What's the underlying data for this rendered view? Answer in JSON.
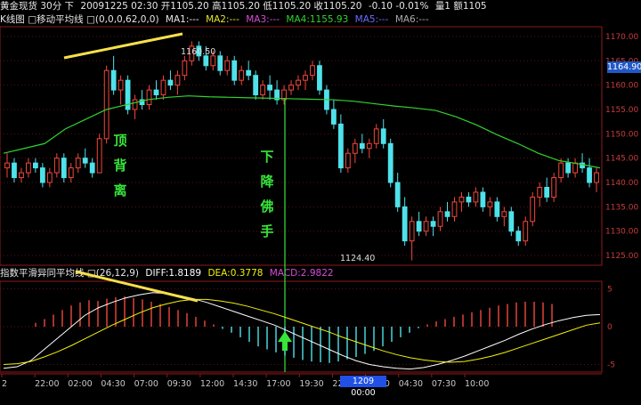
{
  "header": {
    "symbol": "黄金现货 30分 下",
    "info": "20091225 02:30 开1105.20 高1105.20 低1105.20 收1105.20",
    "change": "-0.10 -0.01%",
    "volume": "量1 额1105"
  },
  "ma_header": {
    "title": "K线图 □移动平均线 □(0,0,0,62,0,0)",
    "ma1": "MA1:---",
    "ma2": "MA2:---",
    "ma3": "MA3:---",
    "ma4": "MA4:1155.93",
    "ma5": "MA5:---",
    "ma6": "MA6:---"
  },
  "macd_header": {
    "title": "指数平滑异同平均线 □(26,12,9)",
    "diff": "DIFF:1.8189",
    "dea": "DEA:0.3778",
    "macd": "MACD:2.9822"
  },
  "annotations": {
    "top_divergence": [
      "顶",
      "背",
      "离"
    ],
    "falling_buddha_hand": [
      "下",
      "降",
      "佛",
      "手"
    ],
    "high_label": "1160.50",
    "low_label": "1124.40"
  },
  "current_price": "1164.90",
  "time_marker": "1209 00:00",
  "price_axis": [
    "1170.00",
    "1165.00",
    "1160.00",
    "1155.00",
    "1150.00",
    "1145.00",
    "1140.00",
    "1135.00",
    "1130.00",
    "1125.00"
  ],
  "macd_axis": [
    "5",
    "0",
    "-5"
  ],
  "time_axis": [
    "2",
    "22:00",
    "02:00",
    "04:30",
    "07:00",
    "09:30",
    "12:00",
    "14:30",
    "17:00",
    "19:30",
    "22:00",
    "02:00",
    "04:30",
    "07:30",
    "10:00"
  ],
  "colors": {
    "up": "#f2483b",
    "down": "#4fe2ea",
    "ma4": "#2fd32f",
    "diff": "#ffffff",
    "dea": "#f2f20a",
    "annotation": "#37e53a",
    "trendline": "#f6e04a"
  },
  "chart_data": {
    "type": "candlestick",
    "candles": [
      [
        1143,
        1146,
        1141,
        1144
      ],
      [
        1144,
        1145,
        1140,
        1141
      ],
      [
        1141,
        1143,
        1140,
        1142
      ],
      [
        1142,
        1145,
        1141,
        1144
      ],
      [
        1144,
        1145,
        1142,
        1143
      ],
      [
        1143,
        1144,
        1139,
        1140
      ],
      [
        1140,
        1143,
        1139,
        1142
      ],
      [
        1142,
        1146,
        1141,
        1145
      ],
      [
        1145,
        1146,
        1140,
        1141
      ],
      [
        1141,
        1144,
        1140,
        1143
      ],
      [
        1143,
        1146,
        1142,
        1145
      ],
      [
        1145,
        1147,
        1143,
        1144
      ],
      [
        1144,
        1145,
        1141,
        1142
      ],
      [
        1142,
        1150,
        1142,
        1149
      ],
      [
        1149,
        1164,
        1148,
        1163
      ],
      [
        1163,
        1166,
        1158,
        1159
      ],
      [
        1159,
        1162,
        1156,
        1161
      ],
      [
        1161,
        1162,
        1154,
        1155
      ],
      [
        1155,
        1158,
        1153,
        1157
      ],
      [
        1157,
        1159,
        1155,
        1156
      ],
      [
        1156,
        1160,
        1155,
        1159
      ],
      [
        1159,
        1161,
        1157,
        1158
      ],
      [
        1158,
        1162,
        1157,
        1161
      ],
      [
        1161,
        1163,
        1159,
        1160
      ],
      [
        1160,
        1163,
        1158,
        1162
      ],
      [
        1162,
        1166,
        1161,
        1165
      ],
      [
        1165,
        1169,
        1164,
        1168
      ],
      [
        1168,
        1169,
        1165,
        1166
      ],
      [
        1166,
        1168,
        1163,
        1164
      ],
      [
        1164,
        1167,
        1163,
        1166
      ],
      [
        1166,
        1167,
        1162,
        1163
      ],
      [
        1163,
        1166,
        1162,
        1165
      ],
      [
        1165,
        1166,
        1160,
        1161
      ],
      [
        1161,
        1164,
        1160,
        1163
      ],
      [
        1163,
        1165,
        1161,
        1162
      ],
      [
        1162,
        1163,
        1157,
        1158
      ],
      [
        1158,
        1161,
        1157,
        1160
      ],
      [
        1160,
        1162,
        1157,
        1159
      ],
      [
        1159,
        1161,
        1156,
        1157
      ],
      [
        1157,
        1160,
        1156,
        1159
      ],
      [
        1159,
        1161,
        1158,
        1160
      ],
      [
        1160,
        1162,
        1159,
        1161
      ],
      [
        1161,
        1163,
        1159,
        1162
      ],
      [
        1162,
        1165,
        1161,
        1164
      ],
      [
        1164,
        1165,
        1158,
        1159
      ],
      [
        1159,
        1160,
        1154,
        1155
      ],
      [
        1155,
        1157,
        1151,
        1152
      ],
      [
        1152,
        1154,
        1142,
        1143
      ],
      [
        1143,
        1147,
        1142,
        1146
      ],
      [
        1146,
        1149,
        1144,
        1148
      ],
      [
        1148,
        1150,
        1146,
        1147
      ],
      [
        1147,
        1149,
        1145,
        1148
      ],
      [
        1148,
        1152,
        1147,
        1151
      ],
      [
        1151,
        1153,
        1147,
        1148
      ],
      [
        1148,
        1149,
        1139,
        1140
      ],
      [
        1140,
        1142,
        1134,
        1135
      ],
      [
        1135,
        1137,
        1127,
        1128
      ],
      [
        1128,
        1133,
        1124,
        1132
      ],
      [
        1132,
        1134,
        1129,
        1130
      ],
      [
        1130,
        1133,
        1129,
        1132
      ],
      [
        1132,
        1133,
        1129,
        1131
      ],
      [
        1131,
        1135,
        1130,
        1134
      ],
      [
        1134,
        1136,
        1132,
        1133
      ],
      [
        1133,
        1137,
        1132,
        1136
      ],
      [
        1136,
        1138,
        1134,
        1137
      ],
      [
        1137,
        1138,
        1135,
        1136
      ],
      [
        1136,
        1139,
        1135,
        1138
      ],
      [
        1138,
        1139,
        1134,
        1135
      ],
      [
        1135,
        1137,
        1133,
        1136
      ],
      [
        1136,
        1137,
        1132,
        1133
      ],
      [
        1133,
        1135,
        1131,
        1134
      ],
      [
        1134,
        1135,
        1129,
        1130
      ],
      [
        1130,
        1131,
        1127,
        1128
      ],
      [
        1128,
        1133,
        1127,
        1132
      ],
      [
        1132,
        1138,
        1131,
        1137
      ],
      [
        1137,
        1140,
        1135,
        1139
      ],
      [
        1139,
        1141,
        1136,
        1137
      ],
      [
        1137,
        1142,
        1136,
        1141
      ],
      [
        1141,
        1145,
        1140,
        1144
      ],
      [
        1144,
        1145,
        1141,
        1142
      ],
      [
        1142,
        1145,
        1141,
        1144
      ],
      [
        1144,
        1146,
        1142,
        1143
      ],
      [
        1143,
        1145,
        1139,
        1140
      ],
      [
        1140,
        1143,
        1138,
        1142
      ]
    ],
    "ma4": [
      1146,
      1147,
      1148,
      1151,
      1153,
      1155,
      1156,
      1157,
      1157.5,
      1157.8,
      1157.6,
      1157.5,
      1157.4,
      1157.3,
      1157.2,
      1157.1,
      1157,
      1156.7,
      1156.2,
      1155.7,
      1155.3,
      1154.8,
      1153.5,
      1151.8,
      1149.8,
      1148,
      1146,
      1144.5,
      1143.8,
      1143
    ],
    "macd_hist": [
      0,
      0.5,
      1,
      1.6,
      2.2,
      2.8,
      3.2,
      3.5,
      3.4,
      3.7,
      3.9,
      4.0,
      3.8,
      3.6,
      3.3,
      3.0,
      2.6,
      2.2,
      1.8,
      1.3,
      0.8,
      0.3,
      -0.3,
      -0.8,
      -1.4,
      -2.0,
      -2.6,
      -3.0,
      -3.4,
      -3.8,
      -4.1,
      -4.4,
      -4.6,
      -4.7,
      -4.8,
      -4.6,
      -4.3,
      -4.0,
      -3.6,
      -3.2,
      -2.6,
      -2.0,
      -1.4,
      -0.8,
      -0.2,
      0.3,
      0.7,
      1.0,
      1.3,
      1.6,
      1.9,
      2.2,
      2.5,
      2.8,
      3.0,
      3.2,
      3.3,
      3.3,
      3.2,
      3.0
    ],
    "diff": [
      -5.5,
      -5.3,
      -4.5,
      -3.0,
      -1.5,
      0,
      1.5,
      2.5,
      3.2,
      3.8,
      4.2,
      4.5,
      4.4,
      4.1,
      3.7,
      3.2,
      2.6,
      2.0,
      1.4,
      0.8,
      0.2,
      -0.6,
      -1.4,
      -2.2,
      -3.0,
      -3.8,
      -4.5,
      -5.0,
      -5.3,
      -5.5,
      -5.6,
      -5.4,
      -5.0,
      -4.5,
      -3.9,
      -3.2,
      -2.5,
      -1.8,
      -1.0,
      -0.3,
      0.3,
      0.8,
      1.2,
      1.5,
      1.6
    ],
    "dea": [
      -5.0,
      -4.9,
      -4.6,
      -4.0,
      -3.3,
      -2.5,
      -1.6,
      -0.7,
      0.2,
      1.0,
      1.8,
      2.5,
      3.0,
      3.4,
      3.6,
      3.6,
      3.4,
      3.1,
      2.7,
      2.2,
      1.7,
      1.1,
      0.5,
      -0.1,
      -0.7,
      -1.4,
      -2.0,
      -2.6,
      -3.2,
      -3.7,
      -4.1,
      -4.4,
      -4.6,
      -4.7,
      -4.6,
      -4.3,
      -3.9,
      -3.4,
      -2.8,
      -2.2,
      -1.6,
      -1.0,
      -0.4,
      0.2,
      0.5
    ],
    "price_range": [
      1123,
      1172
    ],
    "macd_range": [
      -6,
      6
    ]
  }
}
